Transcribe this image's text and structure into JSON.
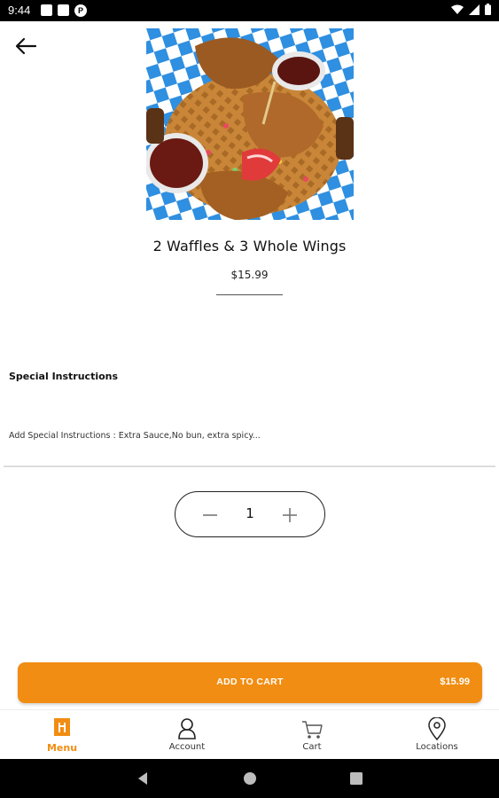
{
  "status_bar": {
    "time": "9:44",
    "notification_badge": "P"
  },
  "item": {
    "title": "2 Waffles & 3 Whole Wings",
    "price": "$15.99"
  },
  "special_instructions": {
    "label": "Special Instructions",
    "placeholder": "Add Special Instructions : Extra Sauce,No bun, extra spicy..."
  },
  "quantity": {
    "value": "1"
  },
  "add_to_cart": {
    "label": "ADD TO CART",
    "price": "$15.99"
  },
  "bottom_nav": {
    "items": [
      {
        "label": "Menu",
        "icon": "menu-icon",
        "active": true
      },
      {
        "label": "Account",
        "icon": "account-icon",
        "active": false
      },
      {
        "label": "Cart",
        "icon": "cart-icon",
        "active": false
      },
      {
        "label": "Locations",
        "icon": "location-pin-icon",
        "active": false
      }
    ]
  },
  "colors": {
    "accent": "#f18d12",
    "status_bar": "#000000",
    "checker_blue": "#2f8fe0"
  }
}
